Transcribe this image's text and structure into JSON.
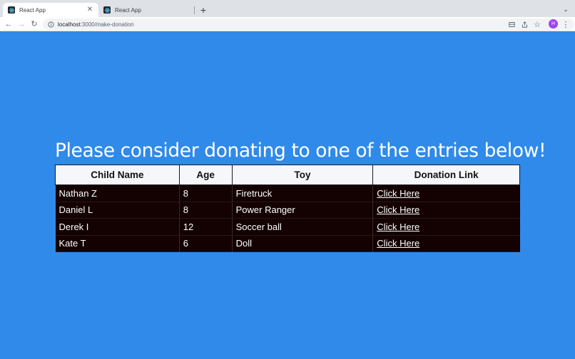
{
  "browser": {
    "tabs": [
      {
        "title": "React App",
        "active": true
      },
      {
        "title": "React App",
        "active": false
      }
    ],
    "url_host": "localhost",
    "url_path": ":3000/make-donation",
    "avatar_letter": "H",
    "icons": [
      "back-arrow-icon",
      "forward-arrow-icon",
      "reload-icon",
      "info-icon",
      "cast-icon",
      "share-icon",
      "star-icon",
      "kebab-menu-icon"
    ]
  },
  "page": {
    "heading": "Please consider donating to one of the entries below!",
    "table": {
      "headers": [
        "Child Name",
        "Age",
        "Toy",
        "Donation Link"
      ],
      "rows": [
        {
          "name": "Nathan Z",
          "age": "8",
          "toy": "Firetruck",
          "link": "Click Here"
        },
        {
          "name": "Daniel L",
          "age": "8",
          "toy": "Power Ranger",
          "link": "Click Here"
        },
        {
          "name": "Derek I",
          "age": "12",
          "toy": "Soccer ball",
          "link": "Click Here"
        },
        {
          "name": "Kate T",
          "age": "6",
          "toy": "Doll",
          "link": "Click Here"
        }
      ]
    },
    "colors": {
      "background": "#2f8aea",
      "table_body": "#140202",
      "table_header": "#f5f7fb"
    }
  }
}
